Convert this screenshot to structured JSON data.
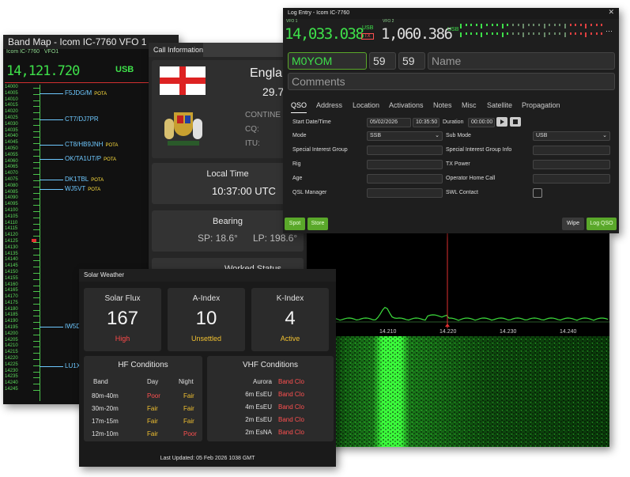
{
  "bandmap": {
    "title": "Band Map - Icom IC-7760 VFO 1",
    "sub_radio": "Icom IC-7760",
    "sub_vfo": "VFO1",
    "frequency": "14,121.720",
    "mode": "USB",
    "ticks": [
      "14000",
      "14005",
      "14010",
      "14015",
      "14020",
      "14025",
      "14030",
      "14035",
      "14040",
      "14045",
      "14050",
      "14055",
      "14060",
      "14065",
      "14070",
      "14075",
      "14080",
      "14085",
      "14090",
      "14095",
      "14100",
      "14105",
      "14110",
      "14115",
      "14120",
      "14125",
      "14130",
      "14135",
      "14140",
      "14145",
      "14150",
      "14155",
      "14160",
      "14165",
      "14170",
      "14175",
      "14180",
      "14185",
      "14190",
      "14195",
      "14200",
      "14205",
      "14210",
      "14215",
      "14220",
      "14225",
      "14230",
      "14235",
      "14240",
      "14245"
    ],
    "spots": [
      {
        "call": "F5JDG/M",
        "tag": "POTA"
      },
      {
        "call": "CT7/DJ7PR",
        "tag": ""
      },
      {
        "call": "CT8/HB9JNH",
        "tag": "POTA"
      },
      {
        "call": "OK/TA1UT/P",
        "tag": "POTA"
      },
      {
        "call": "DK1TBL",
        "tag": "POTA"
      },
      {
        "call": "WJ5VT",
        "tag": "POTA"
      },
      {
        "call": "IW5D",
        "tag": ""
      },
      {
        "call": "LU1X",
        "tag": ""
      }
    ]
  },
  "callinfo": {
    "title": "Call Information",
    "country": "England",
    "distance": "29.7",
    "continent_label": "CONTINE",
    "cq_label": "CQ:",
    "itu_label": "ITU:",
    "local_time_label": "Local Time",
    "local_time": "10:37:00 UTC ",
    "bearing_label": "Bearing",
    "sp": "SP: 18.6°",
    "lp": "LP: 198.6°",
    "worked_status": "Worked Status"
  },
  "logentry": {
    "title": "Log Entry - Icom IC-7760",
    "vfo1_label": "VFO 1",
    "vfo1_freq": "14,033.038",
    "vfo1_mode": "USB",
    "tx_badge": "TX",
    "vfo2_label": "VFO 2",
    "vfo2_freq": "1,060.386",
    "vfo2_mode": "USB",
    "callsign": "M0YOM",
    "rst_sent": "59",
    "rst_rcvd": "59",
    "name_placeholder": "Name",
    "comments_placeholder": "Comments",
    "tabs": [
      "QSO",
      "Address",
      "Location",
      "Activations",
      "Notes",
      "Misc",
      "Satellite",
      "Propagation"
    ],
    "start_label": "Start Date/Time",
    "start_date": "05/02/2026",
    "start_time": "10:35:50",
    "duration_label": "Duration",
    "duration": "00:00:00",
    "mode_label": "Mode",
    "mode_value": "SSB",
    "submode_label": "Sub Mode",
    "submode_value": "USB",
    "sig_label": "Special Interest Group",
    "sig_info_label": "Special Interest Group Info",
    "rig_label": "Rig",
    "txpower_label": "TX Power",
    "age_label": "Age",
    "home_call_label": "Operator Home Call",
    "qsl_label": "QSL Manager",
    "swl_label": "SWL Contact",
    "spot_btn": "Spot",
    "store_btn": "Store",
    "wipe_btn": "Wipe",
    "log_btn": "Log QSO"
  },
  "waterfall": {
    "labels": [
      "14.200",
      "14.210",
      "14.220",
      "14.230",
      "14.240"
    ]
  },
  "solar": {
    "title": "Solar Weather",
    "cards": [
      {
        "h": "Solar Flux",
        "v": "167",
        "s": "High",
        "color": "#ff4a4a"
      },
      {
        "h": "A-Index",
        "v": "10",
        "s": "Unsettled",
        "color": "#f0c030"
      },
      {
        "h": "K-Index",
        "v": "4",
        "s": "Active",
        "color": "#f0c030"
      }
    ],
    "hf_title": "HF Conditions",
    "hf_head": [
      "Band",
      "Day",
      "Night"
    ],
    "hf_rows": [
      {
        "band": "80m-40m",
        "day": "Poor",
        "night": "Fair"
      },
      {
        "band": "30m-20m",
        "day": "Fair",
        "night": "Fair"
      },
      {
        "band": "17m-15m",
        "day": "Fair",
        "night": "Fair"
      },
      {
        "band": "12m-10m",
        "day": "Fair",
        "night": "Poor"
      }
    ],
    "vhf_title": "VHF Conditions",
    "vhf_rows": [
      {
        "name": "Aurora",
        "status": "Band Clo"
      },
      {
        "name": "6m EsEU",
        "status": "Band Clo"
      },
      {
        "name": "4m EsEU",
        "status": "Band Clo"
      },
      {
        "name": "2m EsEU",
        "status": "Band Clo"
      },
      {
        "name": "2m EsNA",
        "status": "Band Clo"
      }
    ],
    "updated": "Last Updated:  05 Feb 2026 1038 GMT"
  }
}
